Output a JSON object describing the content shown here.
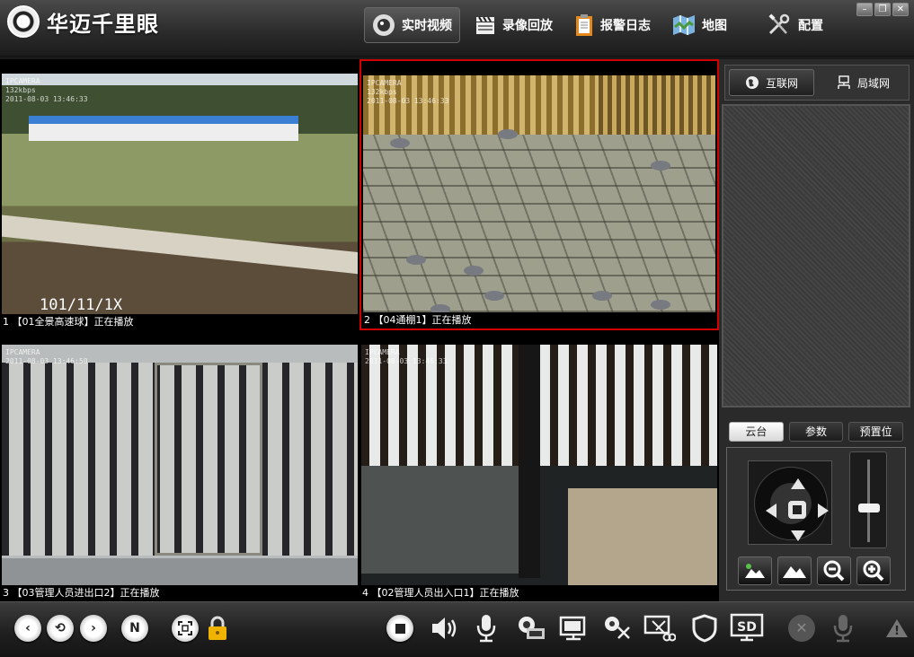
{
  "app": {
    "title": "华迈千里眼",
    "nav": [
      {
        "label": "实时视频",
        "icon": "camera-lens-icon",
        "active": true
      },
      {
        "label": "录像回放",
        "icon": "clapperboard-icon",
        "active": false
      },
      {
        "label": "报警日志",
        "icon": "clipboard-icon",
        "active": false
      },
      {
        "label": "地图",
        "icon": "map-icon",
        "active": false
      },
      {
        "label": "配置",
        "icon": "tools-icon",
        "active": false
      }
    ],
    "window_controls": [
      "minimize-icon",
      "restore-icon",
      "close-icon"
    ]
  },
  "video_cells": [
    {
      "caption": "1 【01全景高速球】正在播放",
      "osd": "IPCAMERA\n132kbps\n2011-08-03 13:46:33",
      "stamp": "101/11/1X",
      "selected": false
    },
    {
      "caption": "2 【04通棚1】正在播放",
      "osd": "IPCAMERA\n132kbps\n2011-08-03 13:46:33",
      "selected": true
    },
    {
      "caption": "3 【03管理人员进出口2】正在播放",
      "osd": "IPCAMERA\n2011-08-03 13:46:50",
      "selected": false
    },
    {
      "caption": "4 【02管理人员出入口1】正在播放",
      "osd": "IPCAMERA\n2011-08-03 13:46:33",
      "selected": false
    }
  ],
  "right_panel": {
    "network_tabs": [
      {
        "label": "互联网",
        "icon": "globe-icon",
        "active": true
      },
      {
        "label": "局域网",
        "icon": "lan-icon",
        "active": false
      }
    ],
    "ptz_tabs": [
      {
        "label": "云台",
        "active": true
      },
      {
        "label": "参数",
        "active": false
      },
      {
        "label": "预置位",
        "active": false
      }
    ],
    "zoom_level": 0.4,
    "ptz_buttons": [
      "focus-near-icon",
      "focus-far-icon",
      "zoom-out-icon",
      "zoom-in-icon"
    ]
  },
  "bottom_toolbar": {
    "left": [
      {
        "name": "previous-button",
        "icon": "chevron-left-icon"
      },
      {
        "name": "cycle-button",
        "icon": "refresh-icon"
      },
      {
        "name": "next-button",
        "icon": "chevron-right-icon"
      },
      {
        "name": "n-button",
        "icon": "n-icon",
        "label": "N"
      },
      {
        "name": "fullscreen-button",
        "icon": "fullscreen-icon"
      },
      {
        "name": "lock-button",
        "icon": "lock-icon"
      }
    ],
    "right": [
      "stop-icon",
      "speaker-icon",
      "microphone-icon",
      "snapshot-icon",
      "record-icon",
      "capture-icon",
      "capture-scissors-icon",
      "shield-icon",
      "sd-icon",
      "disabled-close-icon",
      "disabled-mic-icon",
      "warning-icon"
    ],
    "sd_label": "SD",
    "warning_label": "!"
  }
}
